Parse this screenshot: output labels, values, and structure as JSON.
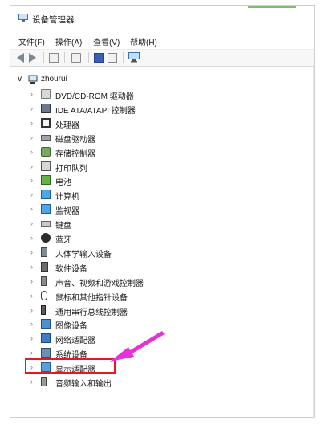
{
  "window": {
    "title": "设备管理器",
    "accent_color": "#7dbd6d"
  },
  "menu": [
    {
      "label": "文件(F)"
    },
    {
      "label": "操作(A)"
    },
    {
      "label": "查看(V)"
    },
    {
      "label": "帮助(H)"
    }
  ],
  "toolbar": {
    "icons": [
      "back-arrow-icon",
      "forward-arrow-icon",
      "properties-icon",
      "update-driver-icon",
      "help-icon",
      "device-view-icon",
      "monitor-icon"
    ]
  },
  "tree": {
    "root": {
      "label": "zhourui",
      "expanded": true,
      "icon": "computer-icon"
    },
    "items": [
      {
        "label": "DVD/CD-ROM 驱动器",
        "icon": "disc-drive-icon"
      },
      {
        "label": "IDE ATA/ATAPI 控制器",
        "icon": "ide-controller-icon"
      },
      {
        "label": "处理器",
        "icon": "processor-icon"
      },
      {
        "label": "磁盘驱动器",
        "icon": "disk-drive-icon"
      },
      {
        "label": "存储控制器",
        "icon": "storage-controller-icon"
      },
      {
        "label": "打印队列",
        "icon": "printer-icon"
      },
      {
        "label": "电池",
        "icon": "battery-icon"
      },
      {
        "label": "计算机",
        "icon": "computer-monitor-icon"
      },
      {
        "label": "监视器",
        "icon": "monitor-icon"
      },
      {
        "label": "键盘",
        "icon": "keyboard-icon"
      },
      {
        "label": "蓝牙",
        "icon": "bluetooth-icon"
      },
      {
        "label": "人体学输入设备",
        "icon": "hid-icon"
      },
      {
        "label": "软件设备",
        "icon": "software-device-icon"
      },
      {
        "label": "声音、视频和游戏控制器",
        "icon": "speaker-icon"
      },
      {
        "label": "鼠标和其他指针设备",
        "icon": "mouse-icon"
      },
      {
        "label": "通用串行总线控制器",
        "icon": "usb-icon"
      },
      {
        "label": "图像设备",
        "icon": "camera-icon"
      },
      {
        "label": "网络适配器",
        "icon": "network-adapter-icon"
      },
      {
        "label": "系统设备",
        "icon": "system-device-icon"
      },
      {
        "label": "显示适配器",
        "icon": "display-adapter-icon",
        "highlighted": true
      },
      {
        "label": "音频输入和输出",
        "icon": "audio-io-icon"
      }
    ]
  },
  "annotation": {
    "highlight_color": "#e8161e",
    "arrow_color": "#e531d6"
  }
}
